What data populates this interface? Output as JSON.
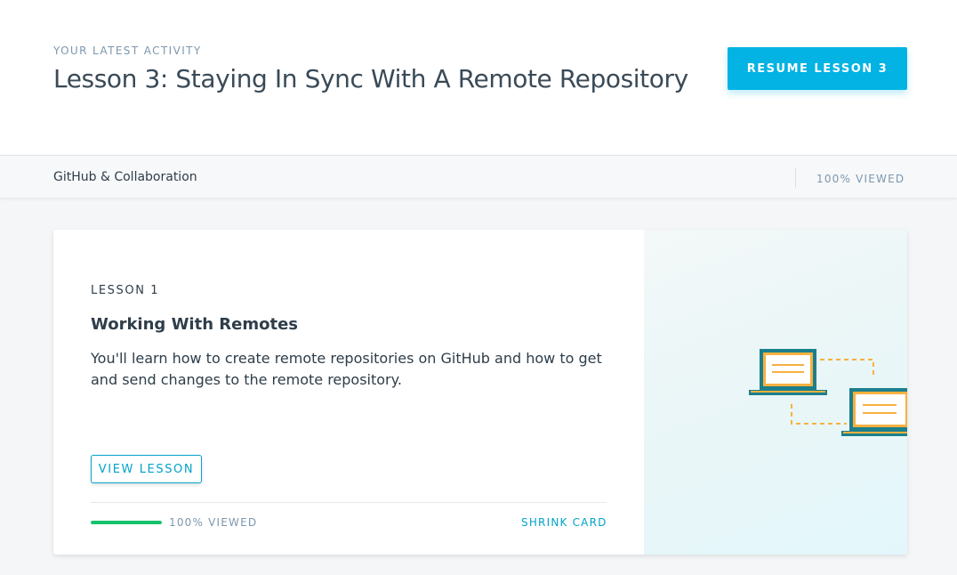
{
  "activity": {
    "eyebrow": "YOUR LATEST ACTIVITY",
    "title": "Lesson 3: Staying In Sync With A Remote Repository",
    "resume_label": "RESUME LESSON 3"
  },
  "course": {
    "name": "GitHub & Collaboration",
    "progress_label": "100% VIEWED"
  },
  "lesson_card": {
    "number_label": "LESSON 1",
    "title": "Working With Remotes",
    "description": "You'll learn how to create remote repositories on GitHub and how to get and send changes to the remote repository.",
    "view_label": "VIEW LESSON",
    "progress_percent": 100,
    "progress_label": "100% VIEWED",
    "shrink_label": "SHRINK CARD",
    "illustration": "two-laptops-sync-icon"
  },
  "colors": {
    "accent": "#02b3e4",
    "link": "#02a3c8",
    "progress": "#15c26b",
    "laptop_frame": "#1b7f8c",
    "laptop_accent": "#f7b13f"
  }
}
